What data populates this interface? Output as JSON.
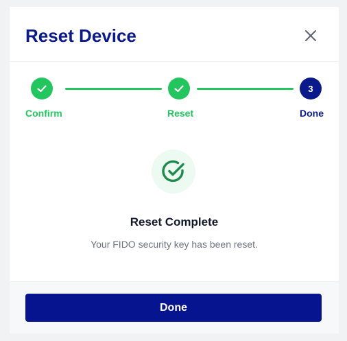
{
  "dialog": {
    "title": "Reset Device",
    "close_icon": "close-icon"
  },
  "stepper": {
    "steps": [
      {
        "label": "Confirm",
        "status": "completed",
        "icon": "check-icon"
      },
      {
        "label": "Reset",
        "status": "completed",
        "icon": "check-icon"
      },
      {
        "label": "Done",
        "status": "current",
        "number": "3"
      }
    ]
  },
  "result": {
    "icon": "check-circle-icon",
    "title": "Reset Complete",
    "message": "Your FIDO security key has been reset."
  },
  "footer": {
    "done_label": "Done"
  },
  "colors": {
    "primary": "#0a1a8a",
    "success": "#22c55e",
    "success_dark": "#1e8a4c",
    "success_bg": "#ecfaf1",
    "text_muted": "#6b7280"
  }
}
